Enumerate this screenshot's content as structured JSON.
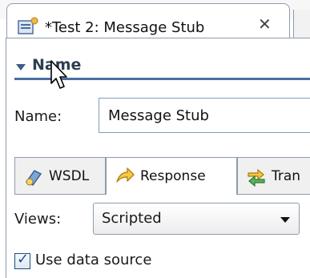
{
  "editor": {
    "tab_title": "*Test 2: Message Stub",
    "close_glyph": "✕",
    "icon": "test-suite-editor-icon"
  },
  "section": {
    "title": "Name",
    "toggle_icon": "collapse-triangle-icon"
  },
  "name_row": {
    "label": "Name:",
    "value": "Message Stub"
  },
  "subtabs": [
    {
      "label": "WSDL",
      "icon": "wsdl-icon",
      "active": false
    },
    {
      "label": "Response",
      "icon": "response-icon",
      "active": true
    },
    {
      "label": "Tran",
      "icon": "transport-icon",
      "active": false
    }
  ],
  "views": {
    "label": "Views:",
    "selected": "Scripted"
  },
  "data_source": {
    "label": "Use data source",
    "checked": true
  },
  "colors": {
    "section_rule": "#4a6fa0",
    "border": "#8e9bad"
  }
}
